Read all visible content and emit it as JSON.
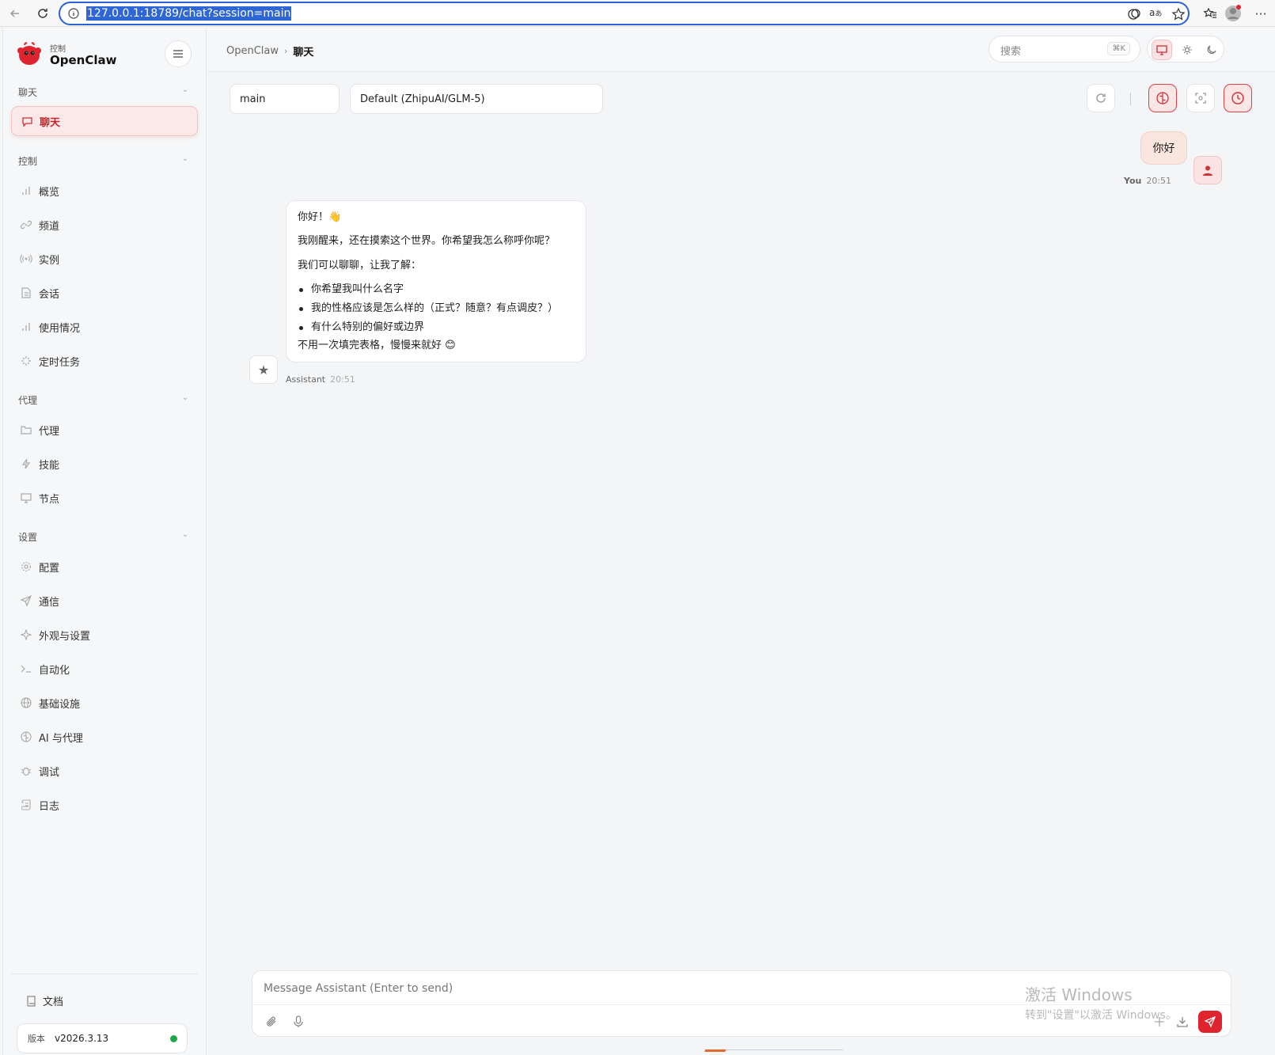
{
  "browser": {
    "url": "127.0.0.1:18789/chat?session=main"
  },
  "brand": {
    "subtitle": "控制",
    "title": "OpenClaw"
  },
  "sidebar": {
    "sections": [
      {
        "label": "聊天"
      },
      {
        "label": "控制"
      },
      {
        "label": "代理"
      },
      {
        "label": "设置"
      }
    ],
    "items": [
      {
        "label": "聊天",
        "icon": "message-icon",
        "active": true
      },
      {
        "label": "概览",
        "icon": "bar-chart-icon"
      },
      {
        "label": "频道",
        "icon": "link-icon"
      },
      {
        "label": "实例",
        "icon": "broadcast-icon"
      },
      {
        "label": "会话",
        "icon": "document-icon"
      },
      {
        "label": "使用情况",
        "icon": "bar-chart-icon"
      },
      {
        "label": "定时任务",
        "icon": "loader-icon"
      },
      {
        "label": "代理",
        "icon": "folder-icon"
      },
      {
        "label": "技能",
        "icon": "lightning-icon"
      },
      {
        "label": "节点",
        "icon": "monitor-icon"
      },
      {
        "label": "配置",
        "icon": "gear-icon"
      },
      {
        "label": "通信",
        "icon": "send-icon"
      },
      {
        "label": "外观与设置",
        "icon": "sparkle-icon"
      },
      {
        "label": "自动化",
        "icon": "terminal-icon"
      },
      {
        "label": "基础设施",
        "icon": "globe-icon"
      },
      {
        "label": "AI 与代理",
        "icon": "brain-icon"
      },
      {
        "label": "调试",
        "icon": "bug-icon"
      },
      {
        "label": "日志",
        "icon": "scroll-icon"
      }
    ],
    "docs_label": "文档",
    "version_label": "版本",
    "version_value": "v2026.3.13"
  },
  "header": {
    "breadcrumb_root": "OpenClaw",
    "breadcrumb_current": "聊天",
    "search_placeholder": "搜索",
    "search_shortcut": "⌘K"
  },
  "chat": {
    "session_value": "main",
    "model_value": "Default (ZhipuAI/GLM-5)",
    "messages": {
      "user": {
        "text": "你好",
        "sender": "You",
        "time": "20:51"
      },
      "assistant": {
        "greeting": "你好！👋",
        "line1": "我刚醒来，还在摸索这个世界。你希望我怎么称呼你呢？",
        "line2": "我们可以聊聊，让我了解：",
        "bullets": [
          "你希望我叫什么名字",
          "我的性格应该是怎么样的（正式？随意？有点调皮？）",
          "有什么特别的偏好或边界"
        ],
        "closing": "不用一次填完表格，慢慢来就好 😊",
        "sender": "Assistant",
        "time": "20:51"
      }
    },
    "composer_placeholder": "Message Assistant (Enter to send)"
  },
  "watermark": {
    "line1": "激活 Windows",
    "line2": "转到\"设置\"以激活 Windows。"
  },
  "colors": {
    "accent": "#d03038",
    "send_button": "#e0242f",
    "status_online": "#1fa64a"
  }
}
